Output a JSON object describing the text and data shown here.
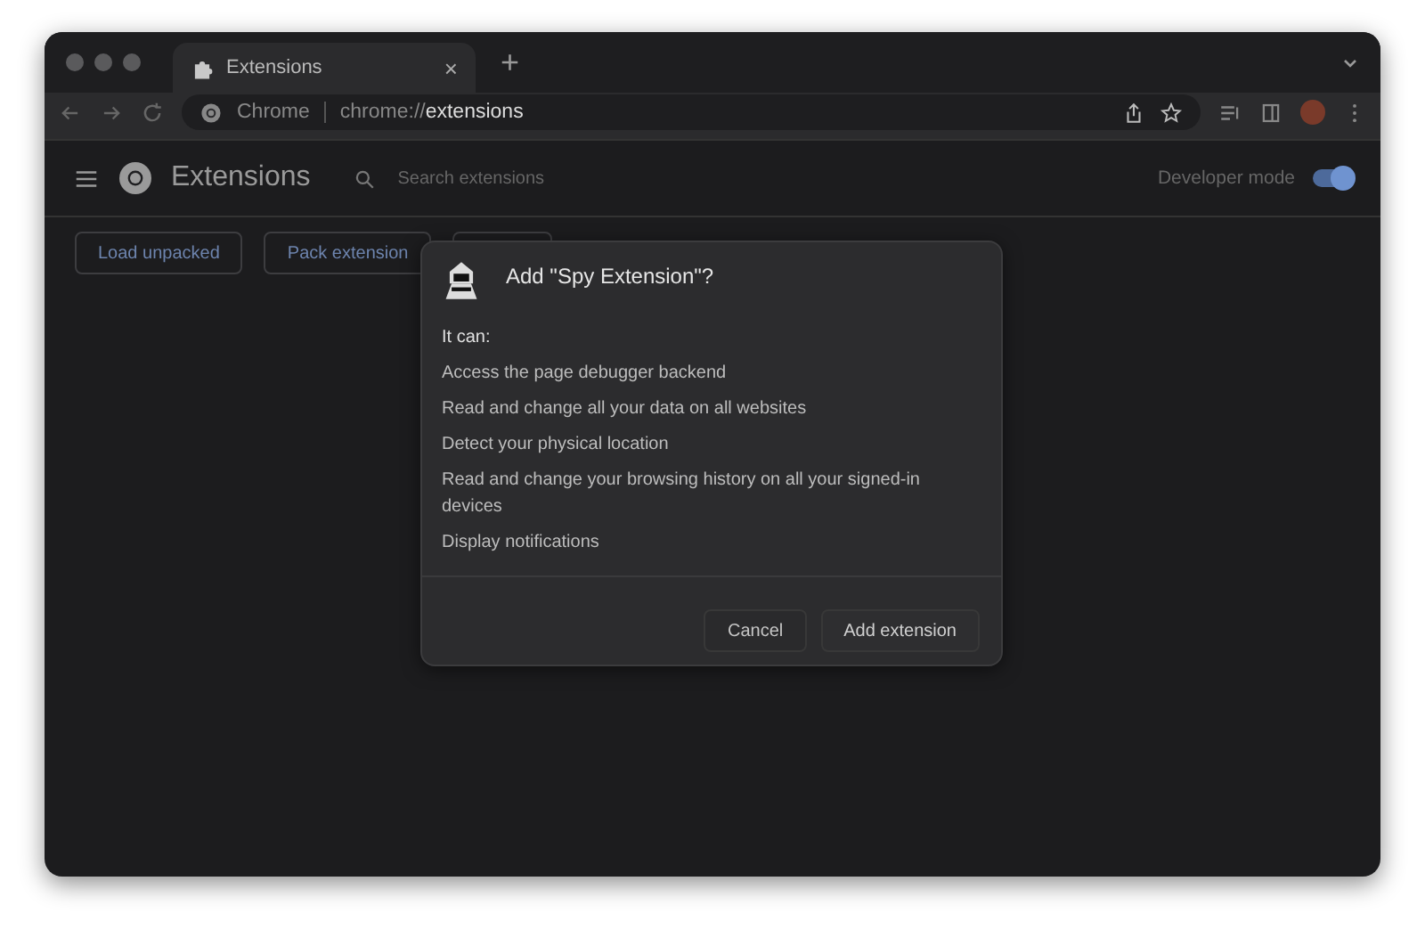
{
  "tab": {
    "title": "Extensions",
    "close": "×"
  },
  "new_tab": "+",
  "address_bar": {
    "site_label": "Chrome",
    "url": "chrome://**extensions**"
  },
  "header": {
    "title": "Extensions",
    "search": {
      "placeholder": "Search extensions"
    },
    "developer_mode": {
      "label": "Developer mode",
      "on": true
    }
  },
  "toolbar_buttons": [
    {
      "label": "Load unpacked"
    },
    {
      "label": "Pack extension"
    }
  ],
  "dialog": {
    "title": "Add \"Spy Extension\"?",
    "intro": "It can:",
    "permissions": [
      "Access the page debugger backend",
      "Read and change all your data on all websites",
      "Detect your physical location",
      "Read and change your browsing history on all your signed-in devices",
      "Display notifications"
    ],
    "buttons": [
      {
        "label": "Cancel",
        "kind": "secondary"
      },
      {
        "label": "Add extension",
        "kind": "primary"
      }
    ]
  }
}
